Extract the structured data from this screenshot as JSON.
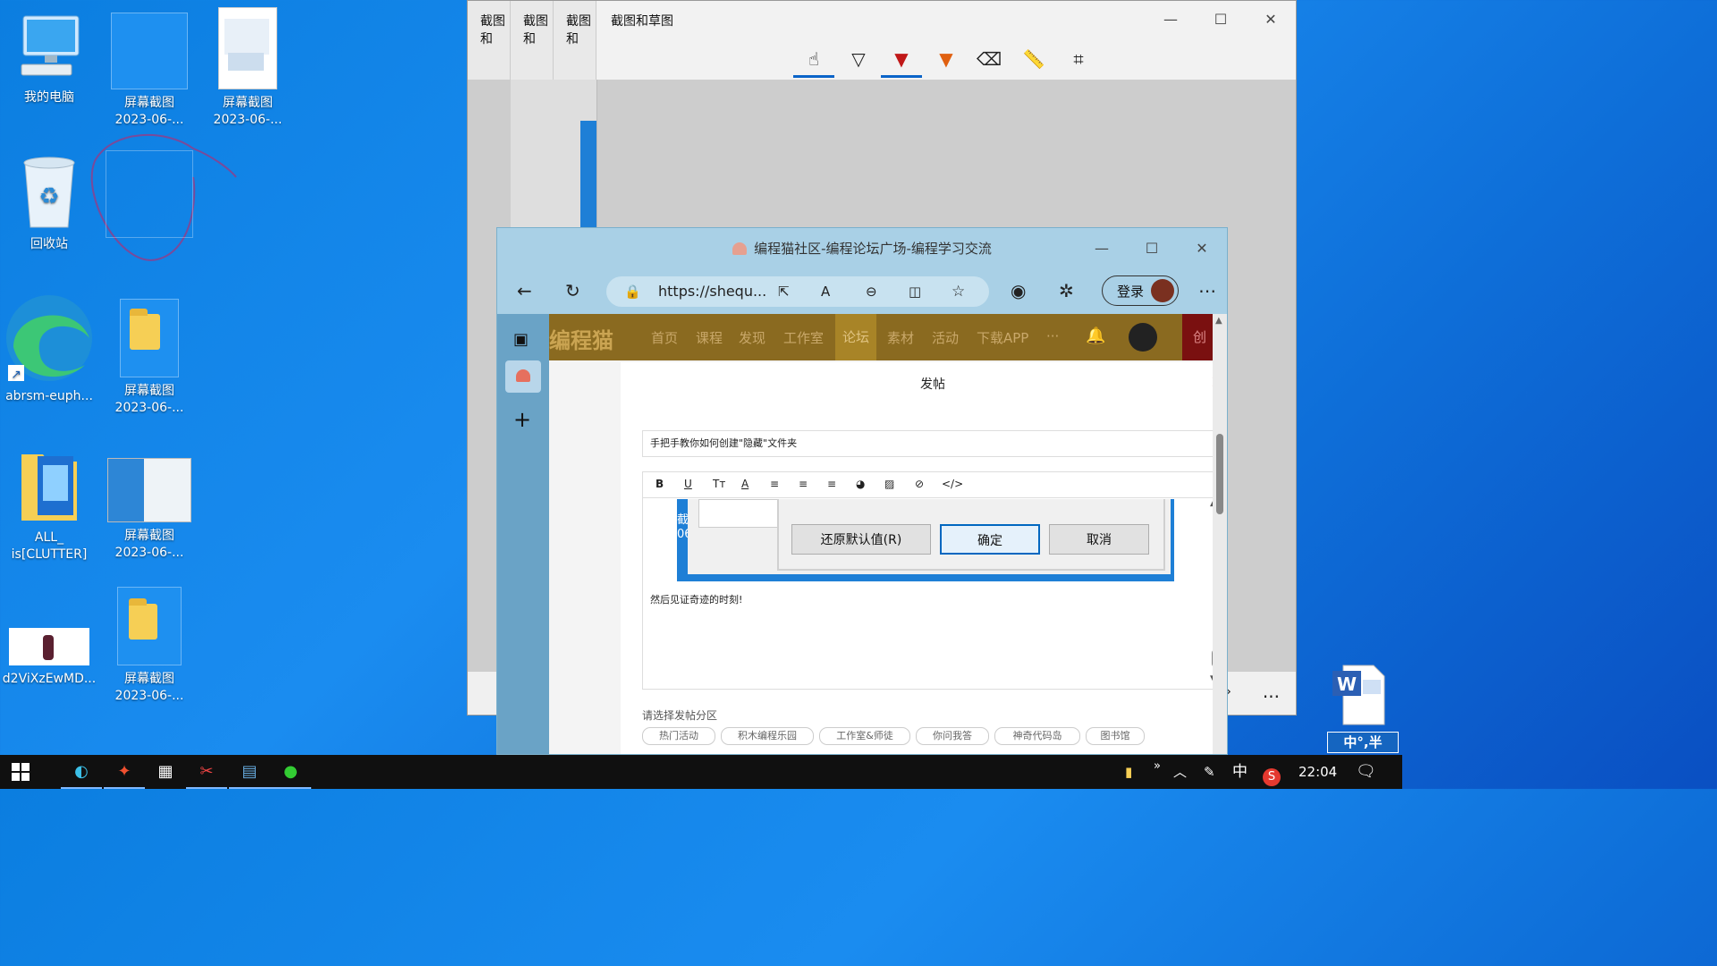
{
  "desktop": {
    "icons": [
      {
        "id": "my-computer",
        "label": "我的电脑"
      },
      {
        "id": "shot1",
        "label": "屏幕截图",
        "label2": "2023-06-..."
      },
      {
        "id": "shot2",
        "label": "屏幕截图",
        "label2": "2023-06-..."
      },
      {
        "id": "recycle",
        "label": "回收站"
      },
      {
        "id": "edge",
        "label": "abrsm-euph..."
      },
      {
        "id": "shot3",
        "label": "屏幕截图",
        "label2": "2023-06-..."
      },
      {
        "id": "all",
        "label": "ALL_",
        "label2": "is[CLUTTER]"
      },
      {
        "id": "shot4",
        "label": "屏幕截图",
        "label2": "2023-06-..."
      },
      {
        "id": "d2v",
        "label": "d2ViXzEwMD..."
      },
      {
        "id": "shot5",
        "label": "屏幕截图",
        "label2": "2023-06-..."
      }
    ]
  },
  "snip": {
    "tabs": [
      "截图和",
      "截图和",
      "截图和"
    ],
    "title": "截图和草图",
    "tools": [
      "touch-icon",
      "ballpoint-icon",
      "pencil-icon",
      "highlighter-icon",
      "eraser-icon",
      "ruler-icon",
      "crop-icon"
    ],
    "more": "..."
  },
  "browser": {
    "title": "编程猫社区-编程论坛广场-编程学习交流",
    "url": "https://shequ...",
    "login_label": "登录",
    "site": {
      "logo": "编程猫",
      "nav": [
        "首页",
        "课程",
        "发现",
        "工作室",
        "论坛",
        "素材",
        "活动",
        "下载APP",
        "···"
      ],
      "cut_text": "创"
    },
    "modal": {
      "title": "发帖",
      "post_title": "手把手教你如何创建\"隐藏\"文件夹",
      "dialog_buttons": [
        "还原默认值(R)",
        "确定",
        "取消"
      ],
      "shot_text1": "截图",
      "shot_text2": "06",
      "body_text": "然后见证奇迹的时刻!",
      "zone_label": "请选择发帖分区",
      "zones": [
        "热门活动",
        "积木编程乐园",
        "工作室&师徒",
        "你问我答",
        "神奇代码岛",
        "图书馆"
      ]
    }
  },
  "taskbar": {
    "time": "22:04",
    "ime_lang": "中",
    "ime_bar": "中°,半",
    "chevron": "»"
  }
}
